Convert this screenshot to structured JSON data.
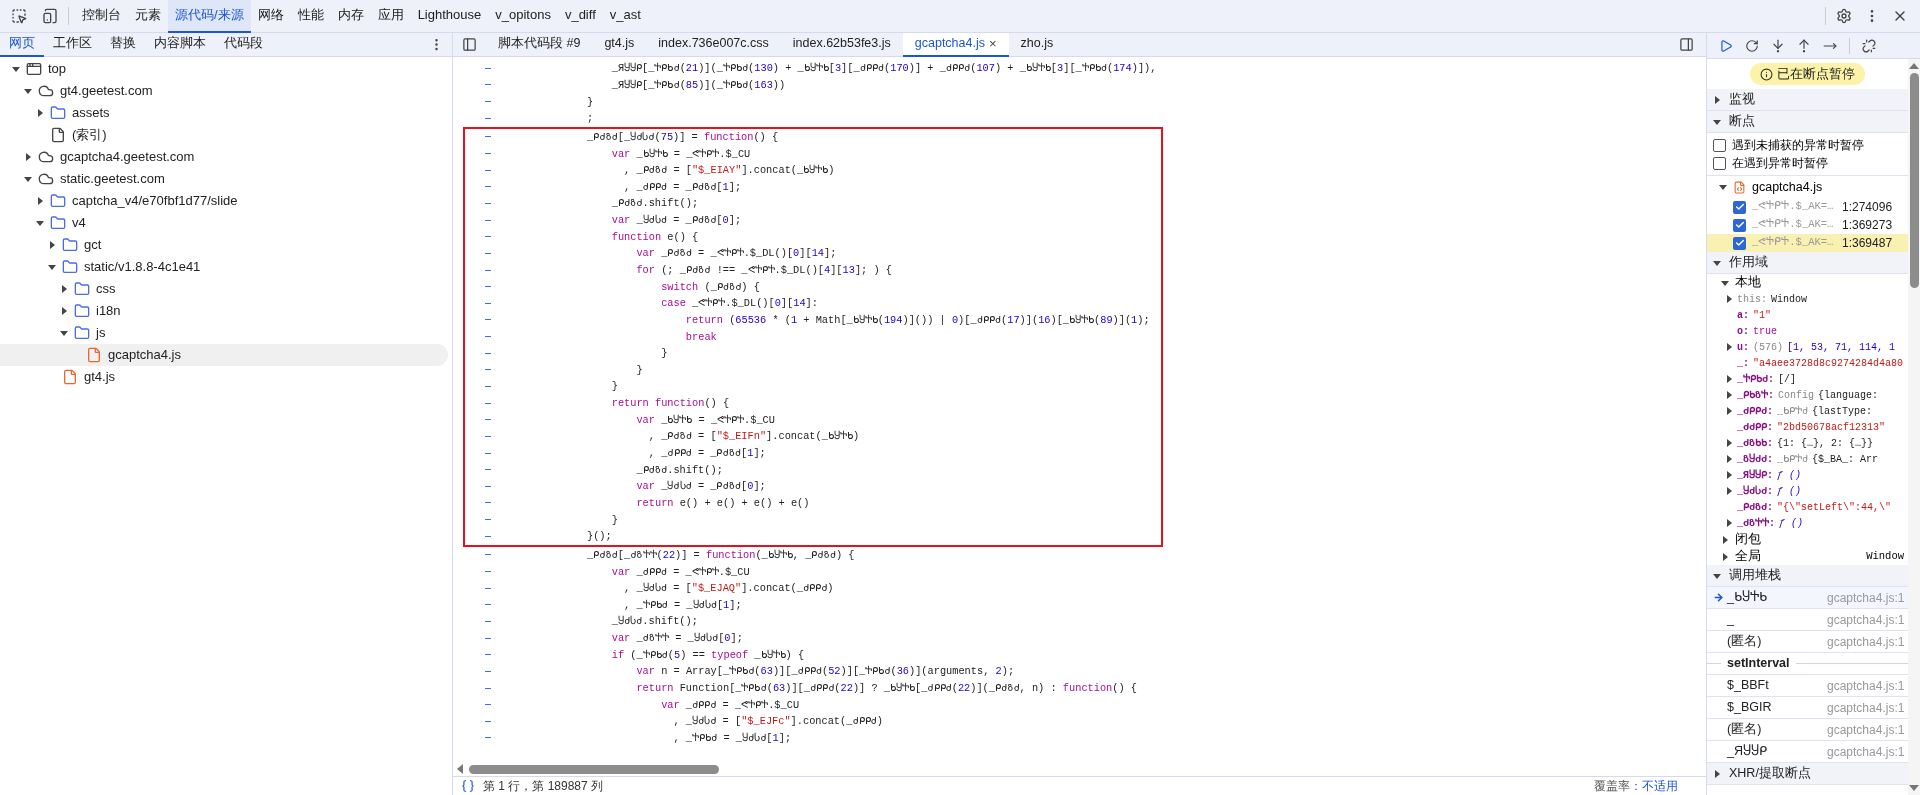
{
  "main_tabs": [
    {
      "label": "控制台",
      "selected": false
    },
    {
      "label": "元素",
      "selected": false
    },
    {
      "label": "源代码/来源",
      "selected": true
    },
    {
      "label": "网络",
      "selected": false
    },
    {
      "label": "性能",
      "selected": false
    },
    {
      "label": "内存",
      "selected": false
    },
    {
      "label": "应用",
      "selected": false
    },
    {
      "label": "Lighthouse",
      "selected": false
    },
    {
      "label": "v_opitons",
      "selected": false
    },
    {
      "label": "v_diff",
      "selected": false
    },
    {
      "label": "v_ast",
      "selected": false
    }
  ],
  "navigator": {
    "tabs": [
      {
        "label": "网页",
        "selected": true
      },
      {
        "label": "工作区",
        "selected": false
      },
      {
        "label": "替换",
        "selected": false
      },
      {
        "label": "内容脚本",
        "selected": false
      },
      {
        "label": "代码段",
        "selected": false
      }
    ],
    "tree": [
      {
        "kind": "frame",
        "label": "top",
        "expanded": true,
        "children": [
          {
            "kind": "cloud",
            "label": "gt4.geetest.com",
            "expanded": true,
            "children": [
              {
                "kind": "folder",
                "label": "assets",
                "expanded": false
              },
              {
                "kind": "file",
                "label": "(索引)",
                "selected": false
              }
            ]
          },
          {
            "kind": "cloud",
            "label": "gcaptcha4.geetest.com",
            "expanded": false
          },
          {
            "kind": "cloud",
            "label": "static.geetest.com",
            "expanded": true,
            "children": [
              {
                "kind": "folder",
                "label": "captcha_v4/e70fbf1d77/slide",
                "expanded": false
              },
              {
                "kind": "folder",
                "label": "v4",
                "expanded": true,
                "children": [
                  {
                    "kind": "folder",
                    "label": "gct",
                    "expanded": false
                  },
                  {
                    "kind": "folder",
                    "label": "static/v1.8.8-4c1e41",
                    "expanded": true,
                    "children": [
                      {
                        "kind": "folder",
                        "label": "css",
                        "expanded": false
                      },
                      {
                        "kind": "folder",
                        "label": "i18n",
                        "expanded": false
                      },
                      {
                        "kind": "folder",
                        "label": "js",
                        "expanded": true,
                        "children": [
                          {
                            "kind": "script",
                            "label": "gcaptcha4.js",
                            "selected": true
                          }
                        ]
                      }
                    ]
                  },
                  {
                    "kind": "script",
                    "label": "gt4.js",
                    "selected": false
                  }
                ]
              }
            ]
          }
        ]
      }
    ]
  },
  "editor": {
    "tabs": [
      {
        "label": "脚本代码段 #9",
        "selected": false,
        "closable": false
      },
      {
        "label": "gt4.js",
        "selected": false,
        "closable": false
      },
      {
        "label": "index.736e007c.css",
        "selected": false,
        "closable": false
      },
      {
        "label": "index.62b53fe3.js",
        "selected": false,
        "closable": false
      },
      {
        "label": "gcaptcha4.js",
        "selected": true,
        "closable": true
      },
      {
        "label": "zho.js",
        "selected": false,
        "closable": false
      }
    ],
    "close_glyph": "×",
    "blocks": [
      {
        "annotated": false,
        "lines": [
          [
            {
              "kind": "txt",
              "text": "    _ЯႸႸᑭ[_Ⴕᑭᑲძ("
            },
            {
              "kind": "num",
              "text": "21"
            },
            {
              "kind": "txt",
              "text": ")](_Ⴕᑭᑲძ("
            },
            {
              "kind": "num",
              "text": "130"
            },
            {
              "kind": "txt",
              "text": ") + _ᑲႸႵᑲ["
            },
            {
              "kind": "num",
              "text": "3"
            },
            {
              "kind": "txt",
              "text": "][_ძᑭᑭძ("
            },
            {
              "kind": "num",
              "text": "170"
            },
            {
              "kind": "txt",
              "text": ")] + _ძᑭᑭძ("
            },
            {
              "kind": "num",
              "text": "107"
            },
            {
              "kind": "txt",
              "text": ") + _ᑲႸႵᑲ["
            },
            {
              "kind": "num",
              "text": "3"
            },
            {
              "kind": "txt",
              "text": "][_Ⴕᑭᑲძ("
            },
            {
              "kind": "num",
              "text": "174"
            },
            {
              "kind": "txt",
              "text": ")]),"
            }
          ],
          [
            {
              "kind": "txt",
              "text": "    _ЯႸႸᑭ[_Ⴕᑭᑲძ("
            },
            {
              "kind": "num",
              "text": "85"
            },
            {
              "kind": "txt",
              "text": ")](_Ⴕᑭᑲძ("
            },
            {
              "kind": "num",
              "text": "163"
            },
            {
              "kind": "txt",
              "text": "))"
            }
          ],
          [
            {
              "kind": "txt",
              "text": "}"
            }
          ],
          [
            {
              "kind": "txt",
              "text": ";"
            }
          ]
        ]
      },
      {
        "annotated": true,
        "lines": [
          [
            {
              "kind": "txt",
              "text": "_ᑭძზძ[_ႸძႱძ("
            },
            {
              "kind": "num",
              "text": "75"
            },
            {
              "kind": "txt",
              "text": ")] = "
            },
            {
              "kind": "kw",
              "text": "function"
            },
            {
              "kind": "txt",
              "text": "() {"
            }
          ],
          [
            {
              "kind": "kw",
              "text": "    var"
            },
            {
              "kind": "txt",
              "text": " _ᑲႸႵᑲ = _ᕙႵᑭႵ.$_CU"
            }
          ],
          [
            {
              "kind": "txt",
              "text": "      , _ᑭძზძ = ["
            },
            {
              "kind": "str",
              "text": "\"$_EIAY\""
            },
            {
              "kind": "txt",
              "text": "].concat(_ᑲႸႵᑲ)"
            }
          ],
          [
            {
              "kind": "txt",
              "text": "      , _ძᑭᑭძ = _ᑭძზძ["
            },
            {
              "kind": "num",
              "text": "1"
            },
            {
              "kind": "txt",
              "text": "];"
            }
          ],
          [
            {
              "kind": "txt",
              "text": "    _ᑭძზძ.shift();"
            }
          ],
          [
            {
              "kind": "kw",
              "text": "    var"
            },
            {
              "kind": "txt",
              "text": " _ႸძႱძ = _ᑭძზძ["
            },
            {
              "kind": "num",
              "text": "0"
            },
            {
              "kind": "txt",
              "text": "];"
            }
          ],
          [
            {
              "kind": "kw",
              "text": "    function"
            },
            {
              "kind": "txt",
              "text": " e() {"
            }
          ],
          [
            {
              "kind": "kw",
              "text": "        var"
            },
            {
              "kind": "txt",
              "text": " _ᑭძზძ = _ᕙႵᑭႵ.$_DL()["
            },
            {
              "kind": "num",
              "text": "0"
            },
            {
              "kind": "txt",
              "text": "]["
            },
            {
              "kind": "num",
              "text": "14"
            },
            {
              "kind": "txt",
              "text": "];"
            }
          ],
          [
            {
              "kind": "kw",
              "text": "        for"
            },
            {
              "kind": "txt",
              "text": " (; _ᑭძზძ !== _ᕙႵᑭႵ.$_DL()["
            },
            {
              "kind": "num",
              "text": "4"
            },
            {
              "kind": "txt",
              "text": "]["
            },
            {
              "kind": "num",
              "text": "13"
            },
            {
              "kind": "txt",
              "text": "]; ) {"
            }
          ],
          [
            {
              "kind": "kw",
              "text": "            switch"
            },
            {
              "kind": "txt",
              "text": " (_ᑭძზძ) {"
            }
          ],
          [
            {
              "kind": "kw",
              "text": "            case"
            },
            {
              "kind": "txt",
              "text": " _ᕙႵᑭႵ.$_DL()["
            },
            {
              "kind": "num",
              "text": "0"
            },
            {
              "kind": "txt",
              "text": "]["
            },
            {
              "kind": "num",
              "text": "14"
            },
            {
              "kind": "txt",
              "text": "]:"
            }
          ],
          [
            {
              "kind": "kw",
              "text": "                return"
            },
            {
              "kind": "txt",
              "text": " ("
            },
            {
              "kind": "num",
              "text": "65536"
            },
            {
              "kind": "txt",
              "text": " * ("
            },
            {
              "kind": "num",
              "text": "1"
            },
            {
              "kind": "txt",
              "text": " + Math[_ᑲႸႵᑲ("
            },
            {
              "kind": "num",
              "text": "194"
            },
            {
              "kind": "txt",
              "text": ")]()) | "
            },
            {
              "kind": "num",
              "text": "0"
            },
            {
              "kind": "txt",
              "text": ")[_ძᑭᑭძ("
            },
            {
              "kind": "num",
              "text": "17"
            },
            {
              "kind": "txt",
              "text": ")]("
            },
            {
              "kind": "num",
              "text": "16"
            },
            {
              "kind": "txt",
              "text": ")[_ᑲႸႵᑲ("
            },
            {
              "kind": "num",
              "text": "89"
            },
            {
              "kind": "txt",
              "text": ")]("
            },
            {
              "kind": "num",
              "text": "1"
            },
            {
              "kind": "txt",
              "text": ");"
            }
          ],
          [
            {
              "kind": "kw",
              "text": "                break"
            }
          ],
          [
            {
              "kind": "txt",
              "text": "            }"
            }
          ],
          [
            {
              "kind": "txt",
              "text": "        }"
            }
          ],
          [
            {
              "kind": "txt",
              "text": "    }"
            }
          ],
          [
            {
              "kind": "kw",
              "text": "    return function"
            },
            {
              "kind": "txt",
              "text": "() {"
            }
          ],
          [
            {
              "kind": "kw",
              "text": "        var"
            },
            {
              "kind": "txt",
              "text": " _ᑲႸႵᑲ = _ᕙႵᑭႵ.$_CU"
            }
          ],
          [
            {
              "kind": "txt",
              "text": "          , _ᑭძზძ = ["
            },
            {
              "kind": "str",
              "text": "\"$_EIFn\""
            },
            {
              "kind": "txt",
              "text": "].concat(_ᑲႸႵᑲ)"
            }
          ],
          [
            {
              "kind": "txt",
              "text": "          , _ძᑭᑭძ = _ᑭძზძ["
            },
            {
              "kind": "num",
              "text": "1"
            },
            {
              "kind": "txt",
              "text": "];"
            }
          ],
          [
            {
              "kind": "txt",
              "text": "        _ᑭძზძ.shift();"
            }
          ],
          [
            {
              "kind": "kw",
              "text": "        var"
            },
            {
              "kind": "txt",
              "text": " _ႸძႱძ = _ᑭძზძ["
            },
            {
              "kind": "num",
              "text": "0"
            },
            {
              "kind": "txt",
              "text": "];"
            }
          ],
          [
            {
              "kind": "kw",
              "text": "        return"
            },
            {
              "kind": "txt",
              "text": " e() + e() + e() + e()"
            }
          ],
          [
            {
              "kind": "txt",
              "text": "    }"
            }
          ],
          [
            {
              "kind": "txt",
              "text": "}();"
            }
          ]
        ]
      },
      {
        "annotated": false,
        "lines": [
          [
            {
              "kind": "txt",
              "text": "_ᑭძზძ[_ძზႵႵ("
            },
            {
              "kind": "num",
              "text": "22"
            },
            {
              "kind": "txt",
              "text": ")] = "
            },
            {
              "kind": "kw",
              "text": "function"
            },
            {
              "kind": "txt",
              "text": "(_ᑲႸႵᑲ, _ᑭძზძ) {"
            }
          ],
          [
            {
              "kind": "kw",
              "text": "    var"
            },
            {
              "kind": "txt",
              "text": " _ძᑭᑭძ = _ᕙႵᑭႵ.$_CU"
            }
          ],
          [
            {
              "kind": "txt",
              "text": "      , _ႸძႱძ = ["
            },
            {
              "kind": "str",
              "text": "\"$_EJAQ\""
            },
            {
              "kind": "txt",
              "text": "].concat(_ძᑭᑭძ)"
            }
          ],
          [
            {
              "kind": "txt",
              "text": "      , _Ⴕᑭᑲძ = _ႸძႱძ["
            },
            {
              "kind": "num",
              "text": "1"
            },
            {
              "kind": "txt",
              "text": "];"
            }
          ],
          [
            {
              "kind": "txt",
              "text": "    _ႸძႱძ.shift();"
            }
          ],
          [
            {
              "kind": "kw",
              "text": "    var"
            },
            {
              "kind": "txt",
              "text": " _ძზႵႵ = _ႸძႱძ["
            },
            {
              "kind": "num",
              "text": "0"
            },
            {
              "kind": "txt",
              "text": "];"
            }
          ],
          [
            {
              "kind": "kw",
              "text": "    if"
            },
            {
              "kind": "txt",
              "text": " (_Ⴕᑭᑲძ("
            },
            {
              "kind": "num",
              "text": "5"
            },
            {
              "kind": "txt",
              "text": ") == "
            },
            {
              "kind": "kw",
              "text": "typeof"
            },
            {
              "kind": "txt",
              "text": " _ᑲႸႵᑲ) {"
            }
          ],
          [
            {
              "kind": "kw",
              "text": "        var"
            },
            {
              "kind": "txt",
              "text": " n = Array[_Ⴕᑭᑲძ("
            },
            {
              "kind": "num",
              "text": "63"
            },
            {
              "kind": "txt",
              "text": ")][_ძᑭᑭძ("
            },
            {
              "kind": "num",
              "text": "52"
            },
            {
              "kind": "txt",
              "text": ")][_Ⴕᑭᑲძ("
            },
            {
              "kind": "num",
              "text": "36"
            },
            {
              "kind": "txt",
              "text": ")](arguments, "
            },
            {
              "kind": "num",
              "text": "2"
            },
            {
              "kind": "txt",
              "text": ");"
            }
          ],
          [
            {
              "kind": "kw",
              "text": "        return"
            },
            {
              "kind": "txt",
              "text": " Function[_Ⴕᑭᑲძ("
            },
            {
              "kind": "num",
              "text": "63"
            },
            {
              "kind": "txt",
              "text": ")][_ძᑭᑭძ("
            },
            {
              "kind": "num",
              "text": "22"
            },
            {
              "kind": "txt",
              "text": ")] ? _ᑲႸႵᑲ[_ძᑭᑭძ("
            },
            {
              "kind": "num",
              "text": "22"
            },
            {
              "kind": "txt",
              "text": ")](_ᑭძზძ, n) : "
            },
            {
              "kind": "kw",
              "text": "function"
            },
            {
              "kind": "txt",
              "text": "() {"
            }
          ],
          [
            {
              "kind": "kw",
              "text": "            var"
            },
            {
              "kind": "txt",
              "text": " _ძᑭᑭძ = _ᕙႵᑭႵ.$_CU"
            }
          ],
          [
            {
              "kind": "txt",
              "text": "              , _ႸძႱძ = ["
            },
            {
              "kind": "str",
              "text": "\"$_EJFc\""
            },
            {
              "kind": "txt",
              "text": "].concat(_ძᑭᑭძ)"
            }
          ],
          [
            {
              "kind": "txt",
              "text": "              , _Ⴕᑭᑲძ = _ႸძႱძ["
            },
            {
              "kind": "num",
              "text": "1"
            },
            {
              "kind": "txt",
              "text": "];"
            }
          ]
        ]
      }
    ],
    "status": {
      "position": "第 1 行，第 189887 列",
      "coverage_label": "覆盖率：",
      "coverage_value": "不适用"
    }
  },
  "debugger": {
    "paused_message": "已在断点暂停",
    "watch": {
      "title": "监视",
      "expanded": false
    },
    "breakpoints": {
      "title": "断点",
      "expanded": true,
      "options": [
        {
          "label": "遇到未捕获的异常时暂停",
          "checked": false
        },
        {
          "label": "在遇到异常时暂停",
          "checked": false
        }
      ],
      "file": {
        "name": "gcaptcha4.js",
        "expanded": true
      },
      "items": [
        {
          "label": "_ᕙႵᑭႵ.$_AK=…",
          "location": "1:274096",
          "checked": true,
          "selected": false
        },
        {
          "label": "_ᕙႵᑭႵ.$_AK=…",
          "location": "1:369273",
          "checked": true,
          "selected": false
        },
        {
          "label": "_ᕙႵᑭႵ.$_AK=…",
          "location": "1:369487",
          "checked": true,
          "selected": true
        }
      ]
    },
    "scope": {
      "title": "作用域",
      "expanded": true,
      "groups": [
        {
          "title": "本地",
          "expanded": true,
          "variables": [
            {
              "name": "this:",
              "dim": true,
              "expandable": true,
              "value": [
                {
                  "kind": "txt",
                  "text": "Window"
                }
              ]
            },
            {
              "name": "a:",
              "dim": false,
              "expandable": false,
              "value": [
                {
                  "kind": "str",
                  "text": "\"1\""
                }
              ]
            },
            {
              "name": "o:",
              "dim": false,
              "expandable": false,
              "value": [
                {
                  "kind": "kw",
                  "text": "true"
                }
              ]
            },
            {
              "name": "u:",
              "dim": false,
              "expandable": true,
              "value": [
                {
                  "kind": "dim",
                  "text": "(576)"
                },
                {
                  "kind": "num",
                  "text": "[1, 53, 71, 114, 1"
                }
              ]
            },
            {
              "name": "_:",
              "dim": false,
              "expandable": false,
              "value": [
                {
                  "kind": "str",
                  "text": "\"a4aee3728d8c9274284d4a80"
                }
              ]
            },
            {
              "name": "_Ⴕᑭᑲძ:",
              "dim": false,
              "expandable": true,
              "value": [
                {
                  "kind": "txt",
                  "text": "[/]"
                }
              ]
            },
            {
              "name": "_ᑭᑲზႵ:",
              "dim": false,
              "expandable": true,
              "value": [
                {
                  "kind": "dim",
                  "text": "Config"
                },
                {
                  "kind": "txt",
                  "text": "{language:"
                }
              ]
            },
            {
              "name": "_ძᑭᑭძ:",
              "dim": false,
              "expandable": true,
              "value": [
                {
                  "kind": "dim",
                  "text": "_ᑲᑭႵძ"
                },
                {
                  "kind": "txt",
                  "text": "{lastType:"
                }
              ]
            },
            {
              "name": "_ძძᑭᑭ:",
              "dim": false,
              "expandable": false,
              "value": [
                {
                  "kind": "str",
                  "text": "\"2bd50678acf12313\""
                }
              ]
            },
            {
              "name": "_ძზᑲᑲ:",
              "dim": false,
              "expandable": true,
              "value": [
                {
                  "kind": "txt",
                  "text": "{1: {…}, 2: {…}}"
                }
              ]
            },
            {
              "name": "_ზႸძძ:",
              "dim": false,
              "expandable": true,
              "value": [
                {
                  "kind": "dim",
                  "text": "_ᑲᑭႵძ"
                },
                {
                  "kind": "txt",
                  "text": "{$_BA_: Arr"
                }
              ]
            },
            {
              "name": "_ЯႸႸᑭ:",
              "dim": false,
              "expandable": true,
              "value": [
                {
                  "kind": "fn",
                  "text": "ƒ ()"
                }
              ]
            },
            {
              "name": "_ႸძႱძ:",
              "dim": false,
              "expandable": true,
              "value": [
                {
                  "kind": "fn",
                  "text": "ƒ ()"
                }
              ]
            },
            {
              "name": "_ᑭძზძ:",
              "dim": false,
              "expandable": false,
              "value": [
                {
                  "kind": "str",
                  "text": "\"{\\\"setLeft\\\":44,\\\""
                }
              ]
            },
            {
              "name": "_ძზႵႵ:",
              "dim": false,
              "expandable": true,
              "value": [
                {
                  "kind": "fn",
                  "text": "ƒ ()"
                }
              ]
            }
          ]
        },
        {
          "title": "闭包",
          "expanded": false
        },
        {
          "title": "全局",
          "expanded": false,
          "value": "Window"
        }
      ]
    },
    "call_stack": {
      "title": "调用堆栈",
      "expanded": true,
      "frames": [
        {
          "kind": "frame",
          "name": "_ᑲႸႵᑲ",
          "location": "gcaptcha4.js:1",
          "current": true
        },
        {
          "kind": "frame",
          "name": "_",
          "location": "gcaptcha4.js:1",
          "current": false
        },
        {
          "kind": "frame",
          "name": "(匿名)",
          "location": "gcaptcha4.js:1",
          "current": false
        },
        {
          "kind": "async",
          "name": "setInterval"
        },
        {
          "kind": "frame",
          "name": "$_BBFt",
          "location": "gcaptcha4.js:1",
          "current": false
        },
        {
          "kind": "frame",
          "name": "$_BGIR",
          "location": "gcaptcha4.js:1",
          "current": false
        },
        {
          "kind": "frame",
          "name": "(匿名)",
          "location": "gcaptcha4.js:1",
          "current": false
        },
        {
          "kind": "frame",
          "name": "_ЯႸႸᑭ",
          "location": "gcaptcha4.js:1",
          "current": false
        }
      ]
    },
    "xhr": {
      "title": "XHR/提取断点",
      "expanded": false
    }
  }
}
